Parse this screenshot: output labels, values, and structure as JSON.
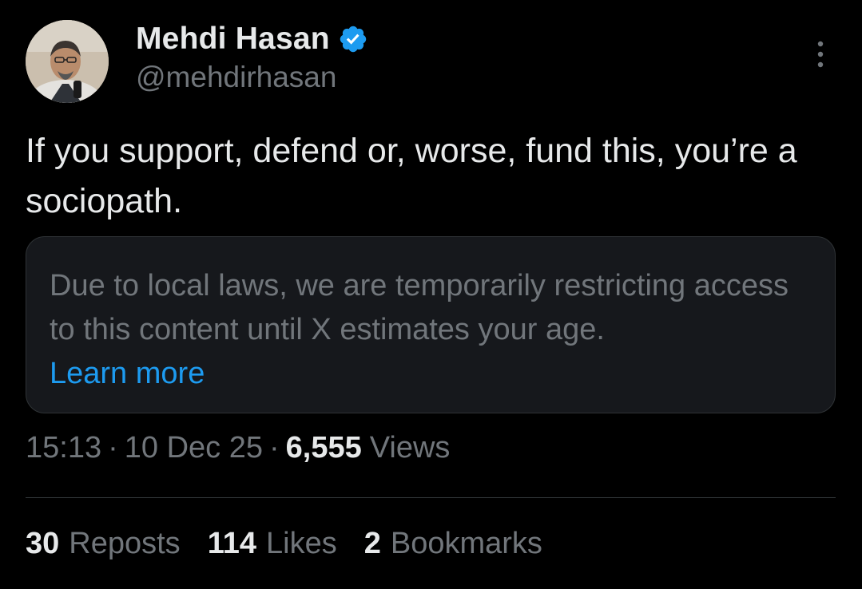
{
  "author": {
    "display_name": "Mehdi Hasan",
    "handle": "@mehdirhasan",
    "verified": true,
    "verified_icon": "verified-badge-icon"
  },
  "menu_icon": "more-options-icon",
  "tweet": {
    "text": "If you support, defend or, worse, fund this, you’re a sociopath."
  },
  "restriction": {
    "message": "Due to local laws, we are temporarily restricting access to this content until X estimates your age.",
    "link_label": "Learn more"
  },
  "meta": {
    "time": "15:13",
    "separator": "·",
    "date": "10 Dec 25",
    "views_count": "6,555",
    "views_label": "Views"
  },
  "stats": [
    {
      "count": "30",
      "label": "Reposts"
    },
    {
      "count": "114",
      "label": "Likes"
    },
    {
      "count": "2",
      "label": "Bookmarks"
    }
  ],
  "colors": {
    "background": "#000000",
    "primary_text": "#e7e9ea",
    "secondary_text": "#71767b",
    "link": "#1d9bf0",
    "verified": "#1d9bf0",
    "box_background": "#16181c",
    "border": "#2f3336"
  }
}
